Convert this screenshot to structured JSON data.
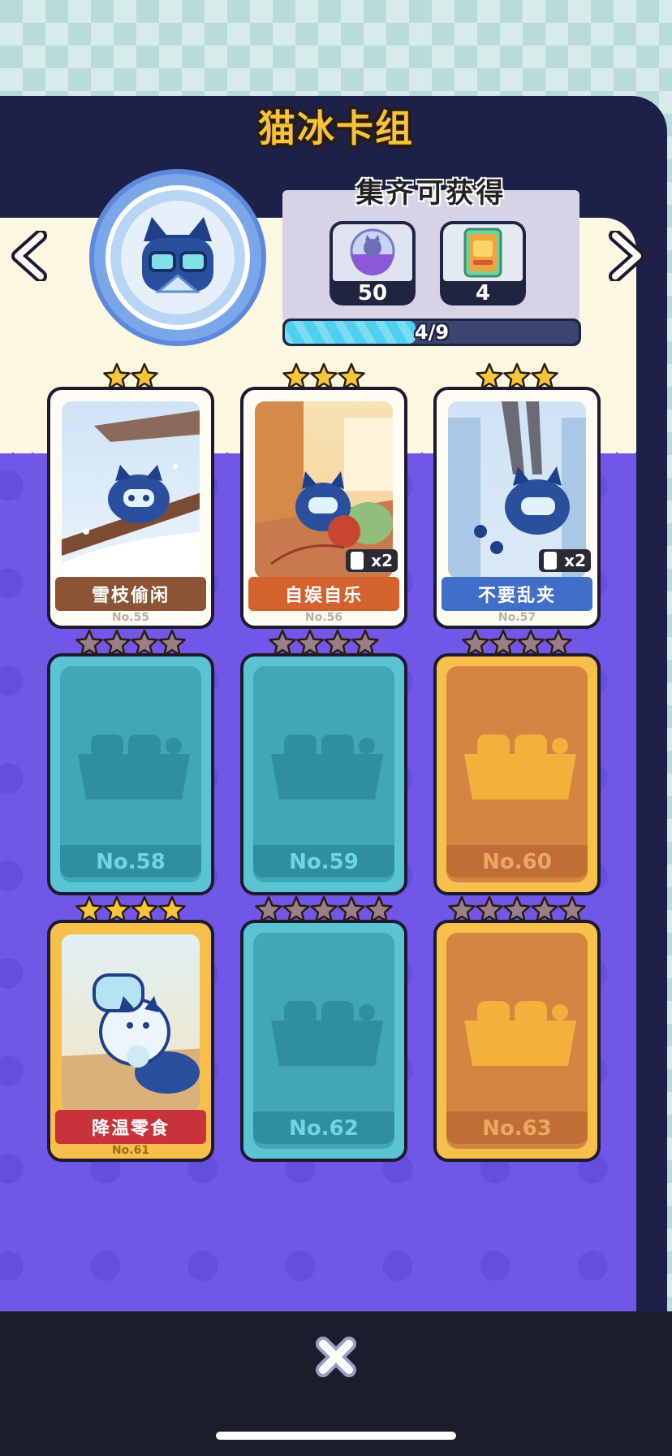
{
  "header": {
    "title": "猫冰卡组"
  },
  "reward": {
    "title": "集齐可获得",
    "items": [
      {
        "icon": "cat-capsule-icon",
        "quantity": "50"
      },
      {
        "icon": "card-pack-icon",
        "quantity": "4"
      }
    ],
    "progress": {
      "collected": 4,
      "total": 9,
      "label": "4/9"
    }
  },
  "cards": [
    {
      "number": "No.55",
      "name": "雪枝偷闲",
      "stars": 2,
      "owned": true,
      "frame": "brown",
      "duplicates": ""
    },
    {
      "number": "No.56",
      "name": "自娱自乐",
      "stars": 3,
      "owned": true,
      "frame": "orange",
      "duplicates": "x2"
    },
    {
      "number": "No.57",
      "name": "不要乱夹",
      "stars": 3,
      "owned": true,
      "frame": "blue",
      "duplicates": "x2"
    },
    {
      "number": "No.58",
      "name": "",
      "stars": 4,
      "owned": false,
      "frame": "teal",
      "duplicates": ""
    },
    {
      "number": "No.59",
      "name": "",
      "stars": 4,
      "owned": false,
      "frame": "teal",
      "duplicates": ""
    },
    {
      "number": "No.60",
      "name": "",
      "stars": 4,
      "owned": false,
      "frame": "gold",
      "duplicates": ""
    },
    {
      "number": "No.61",
      "name": "降温零食",
      "stars": 4,
      "owned": true,
      "frame": "red",
      "duplicates": ""
    },
    {
      "number": "No.62",
      "name": "",
      "stars": 5,
      "owned": false,
      "frame": "teal",
      "duplicates": ""
    },
    {
      "number": "No.63",
      "name": "",
      "stars": 5,
      "owned": false,
      "frame": "gold",
      "duplicates": ""
    }
  ],
  "colors": {
    "accent_gold": "#f5c23a",
    "panel_purple": "#7157e6",
    "progress_fill": "#4fd0ee",
    "star_lit": "#f7c53a",
    "star_unlit": "#9a7f86"
  },
  "controls": {
    "prev_icon": "chevron-left-icon",
    "next_icon": "chevron-right-icon",
    "close_icon": "close-icon"
  }
}
